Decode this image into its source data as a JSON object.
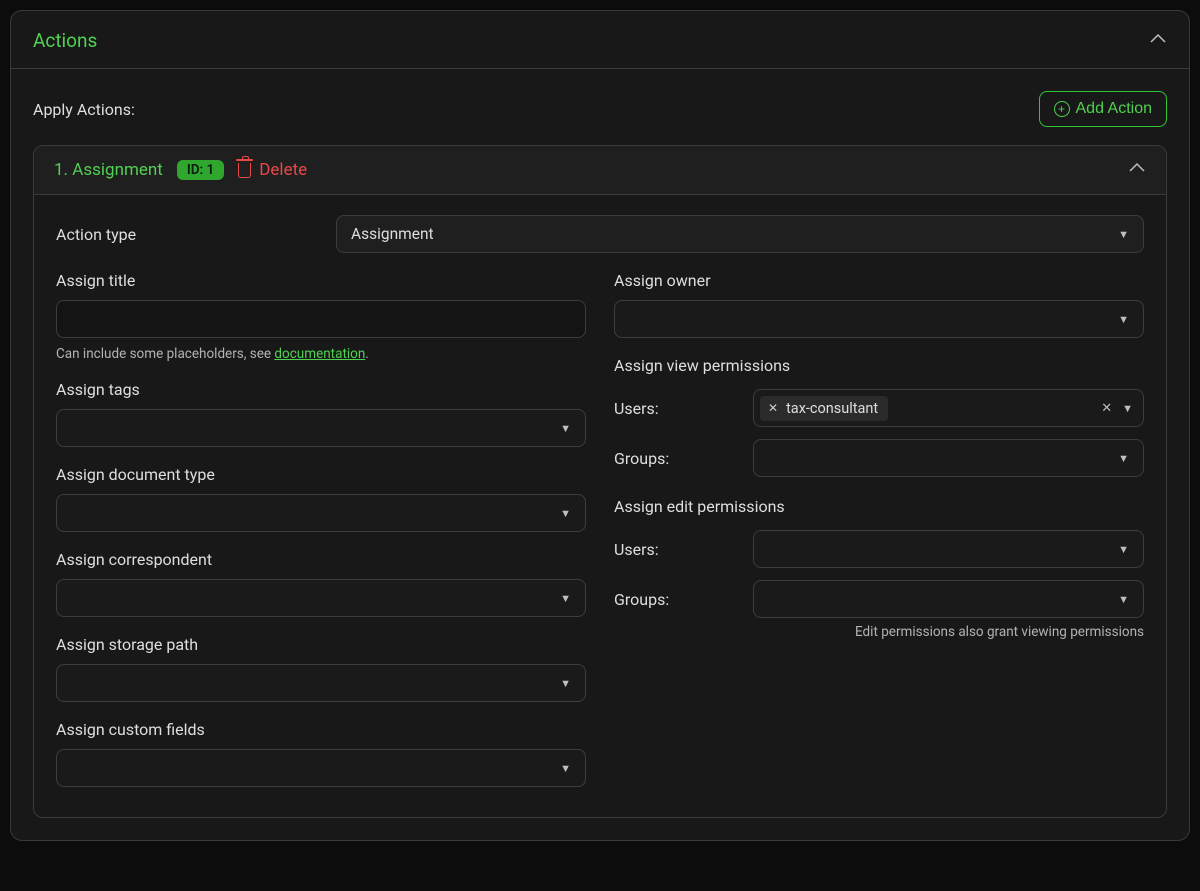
{
  "section": {
    "title": "Actions",
    "apply_label": "Apply Actions:",
    "add_action_label": "Add Action"
  },
  "action": {
    "title": "1. Assignment",
    "badge": "ID: 1",
    "delete_label": "Delete",
    "type_label": "Action type",
    "type_value": "Assignment"
  },
  "left": {
    "assign_title": "Assign title",
    "title_hint_prefix": "Can include some placeholders, see ",
    "title_hint_link": "documentation",
    "title_hint_suffix": ".",
    "assign_tags": "Assign tags",
    "assign_doc_type": "Assign document type",
    "assign_correspondent": "Assign correspondent",
    "assign_storage_path": "Assign storage path",
    "assign_custom_fields": "Assign custom fields"
  },
  "right": {
    "assign_owner": "Assign owner",
    "view_perm_heading": "Assign view permissions",
    "edit_perm_heading": "Assign edit permissions",
    "users_label": "Users:",
    "groups_label": "Groups:",
    "view_user_chip": "tax-consultant",
    "edit_note": "Edit permissions also grant viewing permissions"
  }
}
